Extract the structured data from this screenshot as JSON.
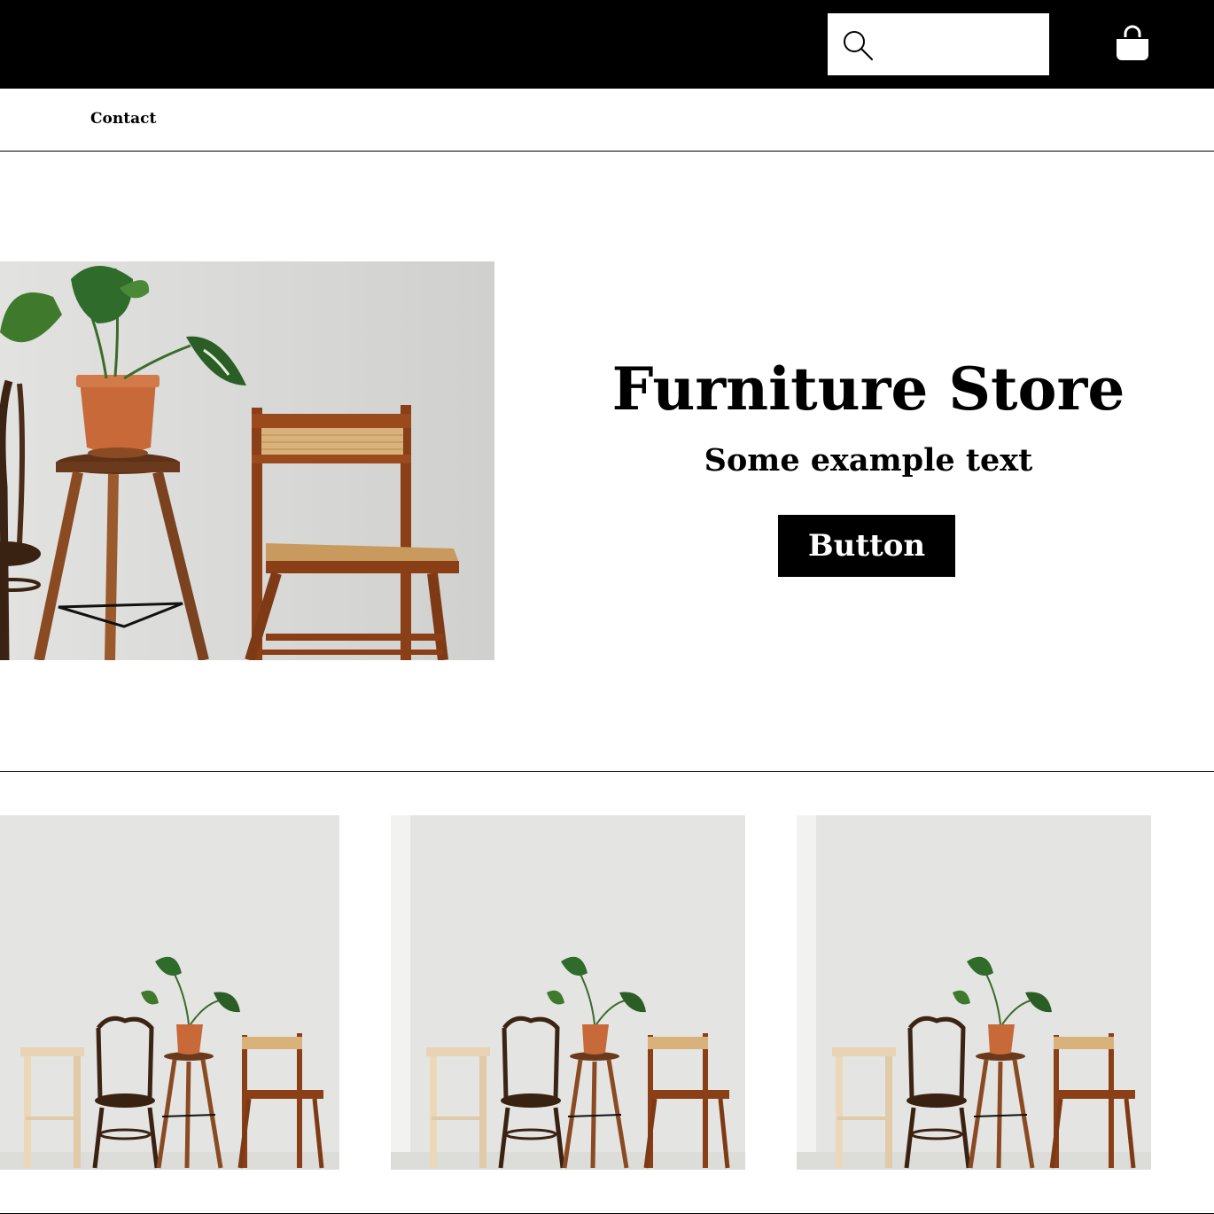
{
  "header": {
    "search": {
      "placeholder": "",
      "value": "",
      "icon": "search-icon"
    },
    "cart_icon": "shopping-bag-icon",
    "background": "#000000"
  },
  "nav": {
    "items": [
      {
        "label": "Contact"
      }
    ]
  },
  "hero": {
    "title": "Furniture Store",
    "subtitle": "Some example text",
    "button_label": "Button",
    "image": "photo-chairs-stool-plant"
  },
  "products": {
    "items": [
      {
        "image": "photo-chair-lineup"
      },
      {
        "image": "photo-chair-lineup"
      },
      {
        "image": "photo-chair-lineup"
      }
    ]
  },
  "colors": {
    "accent": "#000000",
    "background": "#ffffff",
    "wood": "#8a4a22",
    "terracotta": "#c8693a",
    "leaf": "#2f6b2a",
    "wall": "#e4e4e2"
  }
}
